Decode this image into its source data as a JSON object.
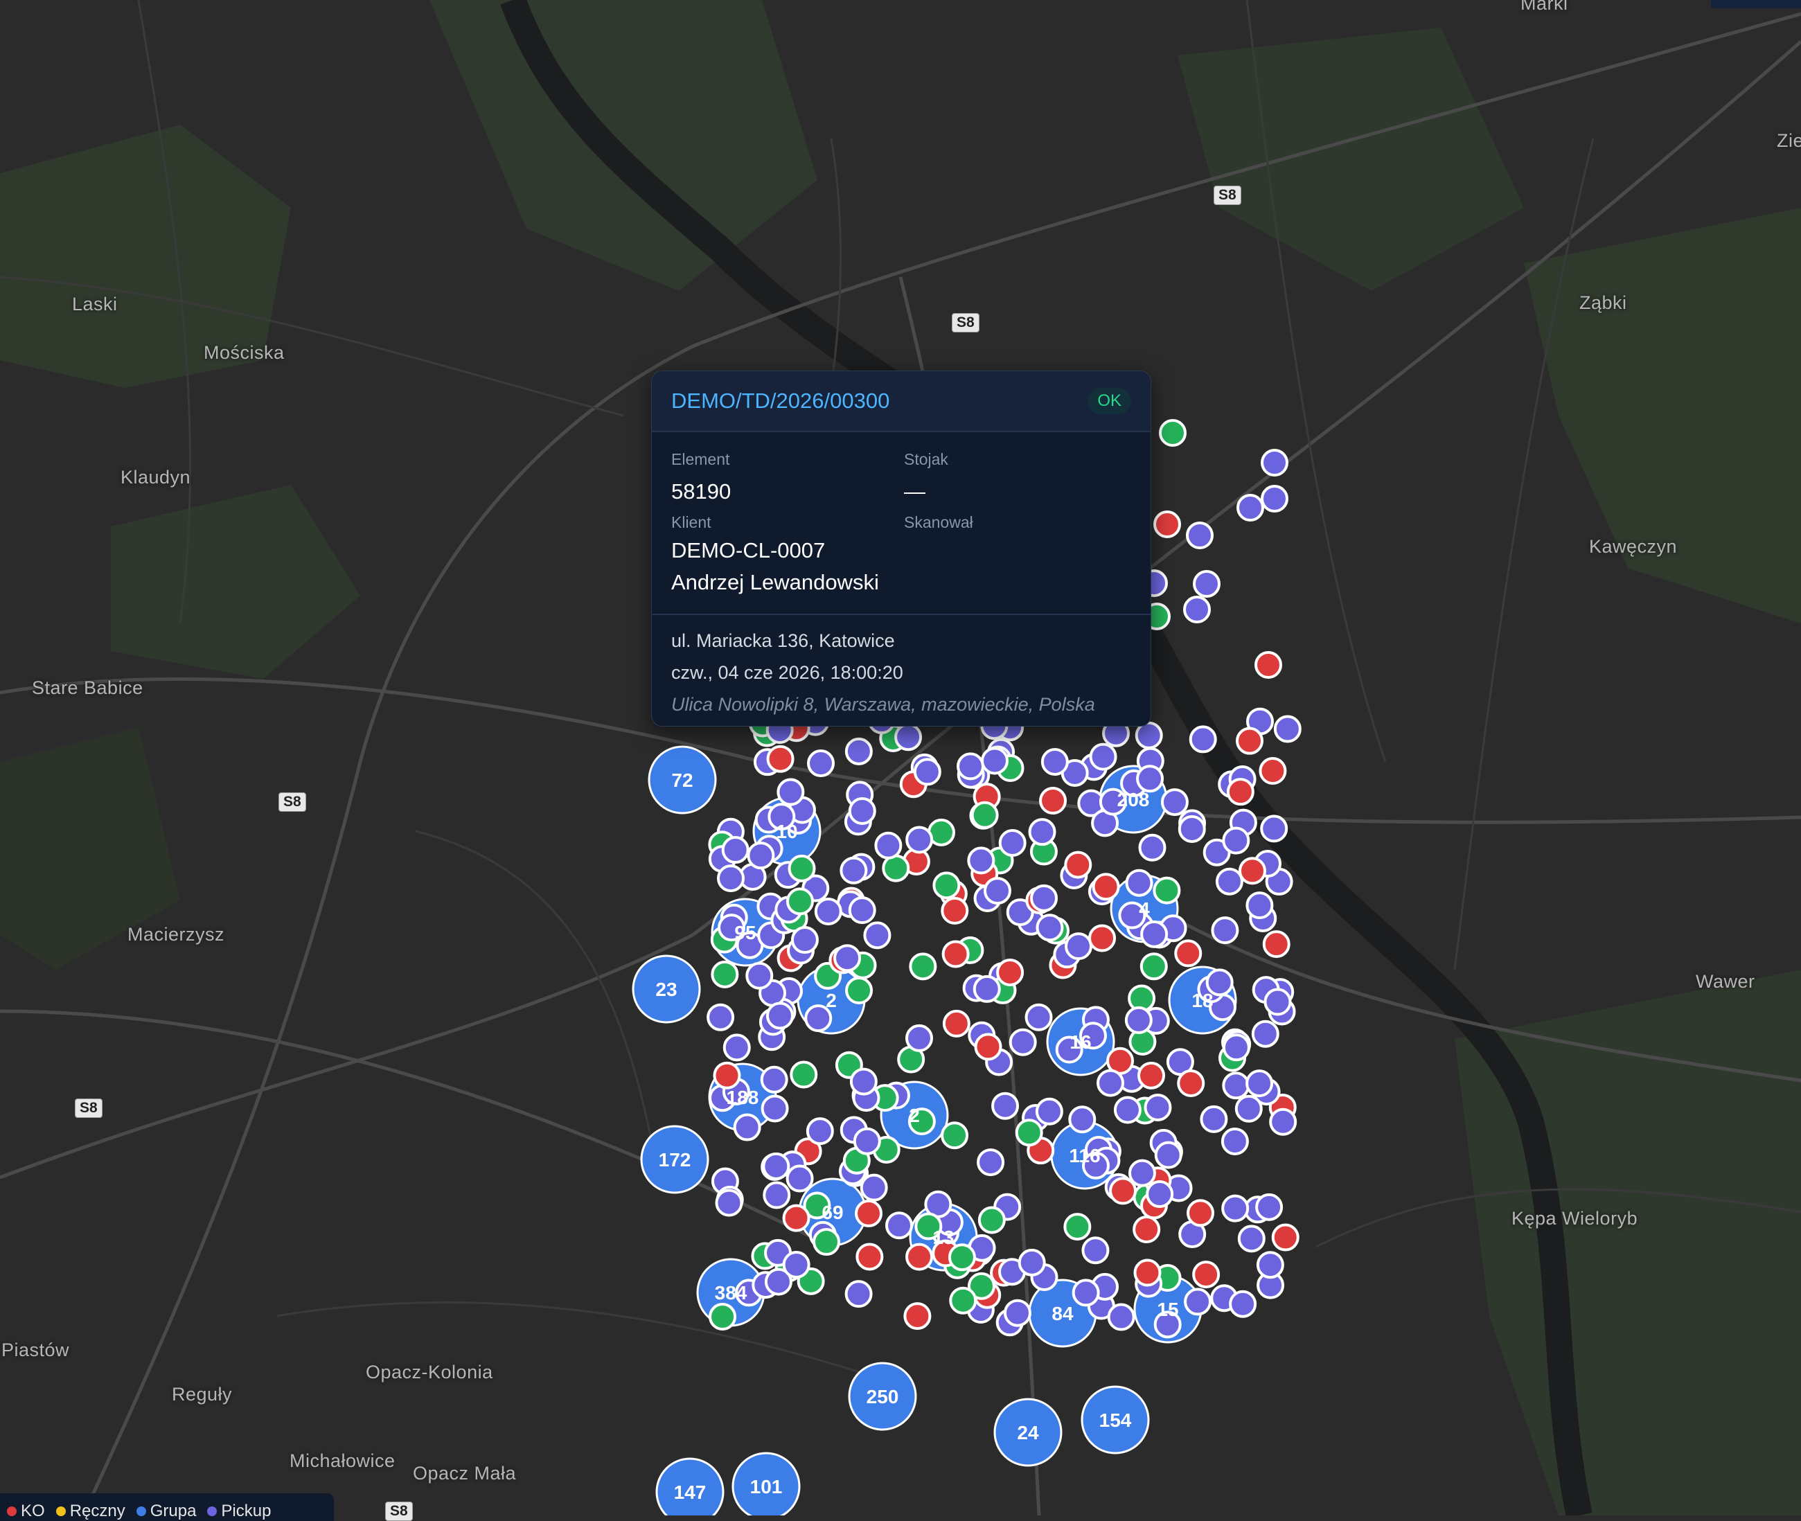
{
  "map": {
    "places": [
      {
        "name": "Marki"
      },
      {
        "name": "Zie"
      },
      {
        "name": "Laski"
      },
      {
        "name": "Mościska"
      },
      {
        "name": "Ząbki"
      },
      {
        "name": "Klaudyn"
      },
      {
        "name": "Kawęczyn"
      },
      {
        "name": "Stare Babice"
      },
      {
        "name": "Macierzysz"
      },
      {
        "name": "Wawer"
      },
      {
        "name": "Kępa Wieloryb"
      },
      {
        "name": "Piastów"
      },
      {
        "name": "Opacz-Kolonia"
      },
      {
        "name": "Reguły"
      },
      {
        "name": "Michałowice"
      },
      {
        "name": "Opacz Mała"
      }
    ],
    "road_shield": "S8",
    "clusters": [
      {
        "count": "72"
      },
      {
        "count": "95"
      },
      {
        "count": "23"
      },
      {
        "count": "188"
      },
      {
        "count": "172"
      },
      {
        "count": "69"
      },
      {
        "count": "384"
      },
      {
        "count": "208"
      },
      {
        "count": "84"
      },
      {
        "count": "250"
      },
      {
        "count": "24"
      },
      {
        "count": "154"
      },
      {
        "count": "147"
      },
      {
        "count": "101"
      },
      {
        "count": "116"
      },
      {
        "count": "15"
      },
      {
        "count": "13"
      },
      {
        "count": "2"
      },
      {
        "count": "2"
      },
      {
        "count": "10"
      },
      {
        "count": "4"
      },
      {
        "count": "18"
      },
      {
        "count": "16"
      }
    ],
    "colors": {
      "cluster": "#3d7de8",
      "pin_purple": "#6b64de",
      "pin_green": "#25b15a",
      "pin_red": "#dd3b3b",
      "background": "#2b2b2b"
    }
  },
  "popup": {
    "title": "DEMO/TD/2026/00300",
    "status": "OK",
    "element_label": "Element",
    "element_value": "58190",
    "rack_label": "Stojak",
    "rack_value": "—",
    "client_label": "Klient",
    "client_id": "DEMO-CL-0007",
    "client_name": "Andrzej Lewandowski",
    "scanned_label": "Skanował",
    "address": "ul. Mariacka 136, Katowice",
    "datetime": "czw., 04 cze 2026, 18:00:20",
    "geo_address": "Ulica Nowolipki 8, Warszawa, mazowieckie, Polska"
  },
  "legend": [
    {
      "label": "KO",
      "color": "#dd3b3b"
    },
    {
      "label": "Ręczny",
      "color": "#f2c21b"
    },
    {
      "label": "Grupa",
      "color": "#3d7de8"
    },
    {
      "label": "Pickup",
      "color": "#6b64de"
    }
  ]
}
